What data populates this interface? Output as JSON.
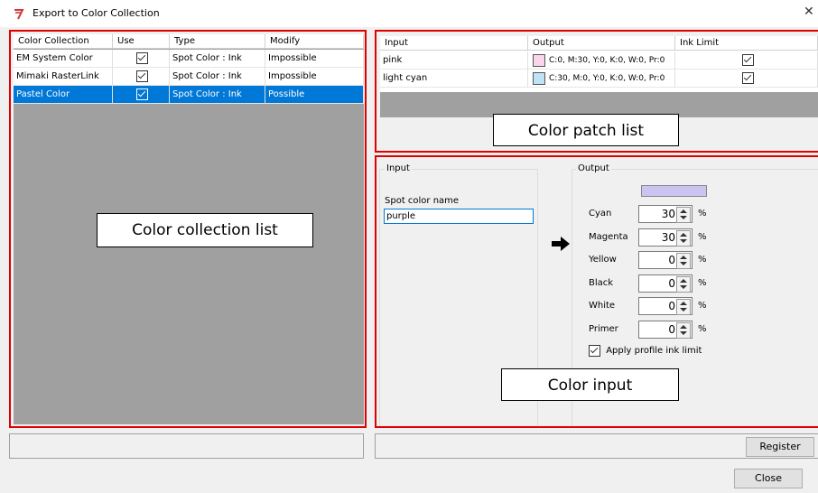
{
  "window": {
    "title": "Export to Color Collection",
    "close_glyph": "✕"
  },
  "collection_table": {
    "headers": [
      "Color Collection",
      "Use",
      "Type",
      "Modify"
    ],
    "rows": [
      {
        "name": "EM System Color",
        "use": true,
        "type": "Spot Color : Ink",
        "modify": "Impossible",
        "selected": false
      },
      {
        "name": "Mimaki RasterLink",
        "use": true,
        "type": "Spot Color : Ink",
        "modify": "Impossible",
        "selected": false
      },
      {
        "name": "Pastel Color",
        "use": true,
        "type": "Spot Color : Ink",
        "modify": "Possible",
        "selected": true
      }
    ]
  },
  "patch_table": {
    "headers": [
      "Input",
      "Output",
      "Ink Limit"
    ],
    "rows": [
      {
        "input": "pink",
        "swatch": "#fbd5ea",
        "output": "C:0, M:30, Y:0, K:0, W:0, Pr:0",
        "ink_limit": true
      },
      {
        "input": "light cyan",
        "swatch": "#bfe3f5",
        "output": "C:30, M:0, Y:0, K:0, W:0, Pr:0",
        "ink_limit": true
      }
    ]
  },
  "annotations": {
    "collection_list": "Color collection list",
    "patch_list": "Color patch list",
    "color_input": "Color input"
  },
  "input_group": {
    "legend": "Input",
    "field_label": "Spot color name",
    "field_value": "purple"
  },
  "output_group": {
    "legend": "Output",
    "preview_color": "#ccc3f0",
    "channels": [
      {
        "label": "Cyan",
        "value": "30",
        "unit": "%"
      },
      {
        "label": "Magenta",
        "value": "30",
        "unit": "%"
      },
      {
        "label": "Yellow",
        "value": "0",
        "unit": "%"
      },
      {
        "label": "Black",
        "value": "0",
        "unit": "%"
      },
      {
        "label": "White",
        "value": "0",
        "unit": "%"
      },
      {
        "label": "Primer",
        "value": "0",
        "unit": "%"
      }
    ],
    "apply_ink_limit_label": "Apply profile ink limit",
    "apply_ink_limit": true
  },
  "buttons": {
    "register": "Register",
    "close": "Close"
  },
  "colors": {
    "highlight": "#e00000",
    "selection": "#0078d7",
    "app_icon": "#d23a3a"
  }
}
